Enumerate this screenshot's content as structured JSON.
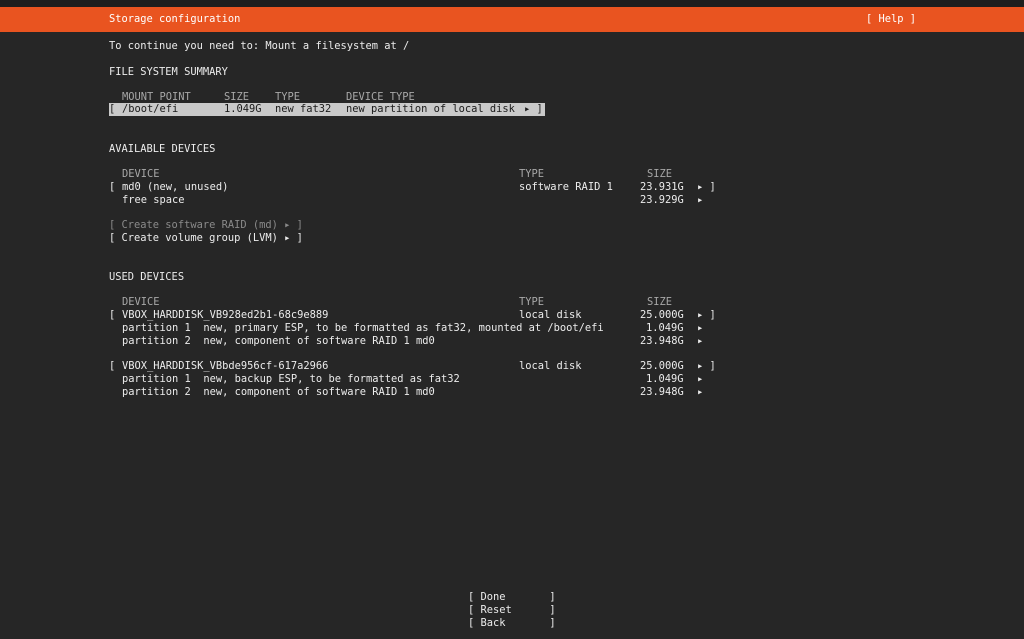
{
  "header": {
    "title": "Storage configuration",
    "help": "[ Help ]"
  },
  "message": "To continue you need to: Mount a filesystem at /",
  "fs_summary": {
    "heading": "FILE SYSTEM SUMMARY",
    "columns": [
      "MOUNT POINT",
      "SIZE",
      "TYPE",
      "DEVICE TYPE"
    ],
    "rows": [
      {
        "open": "[",
        "mount": "/boot/efi",
        "size": "1.049G",
        "type": "new fat32",
        "device_type": "new partition of local disk",
        "close": "▸ ]"
      }
    ]
  },
  "available": {
    "heading": "AVAILABLE DEVICES",
    "columns": [
      "DEVICE",
      "TYPE",
      "SIZE"
    ],
    "md0": {
      "open": "[",
      "device": "md0 (new, unused)",
      "type": "software RAID 1",
      "size": "23.931G",
      "close": "▸ ]"
    },
    "free": {
      "device": "free space",
      "size": "23.929G",
      "arrow": "▸"
    },
    "create_raid": "[ Create software RAID (md) ▸ ]",
    "create_lvm": "[ Create volume group (LVM) ▸ ]"
  },
  "used": {
    "heading": "USED DEVICES",
    "columns": [
      "DEVICE",
      "TYPE",
      "SIZE"
    ],
    "disk1": {
      "open": "[",
      "name": "VBOX_HARDDISK_VB928ed2b1-68c9e889",
      "type": "local disk",
      "size": "25.000G",
      "close": "▸ ]",
      "partitions": [
        {
          "label": "partition 1  new, primary ESP, to be formatted as fat32, mounted at /boot/efi",
          "size": "1.049G",
          "arrow": "▸"
        },
        {
          "label": "partition 2  new, component of software RAID 1 md0",
          "size": "23.948G",
          "arrow": "▸"
        }
      ]
    },
    "disk2": {
      "open": "[",
      "name": "VBOX_HARDDISK_VBbde956cf-617a2966",
      "type": "local disk",
      "size": "25.000G",
      "close": "▸ ]",
      "partitions": [
        {
          "label": "partition 1  new, backup ESP, to be formatted as fat32",
          "size": "1.049G",
          "arrow": "▸"
        },
        {
          "label": "partition 2  new, component of software RAID 1 md0",
          "size": "23.948G",
          "arrow": "▸"
        }
      ]
    }
  },
  "buttons": {
    "done": "[ Done       ]",
    "reset": "[ Reset      ]",
    "back": "[ Back       ]"
  },
  "colors": {
    "accent": "#e95420",
    "background": "#262626",
    "selection": "#c9c9c9"
  }
}
